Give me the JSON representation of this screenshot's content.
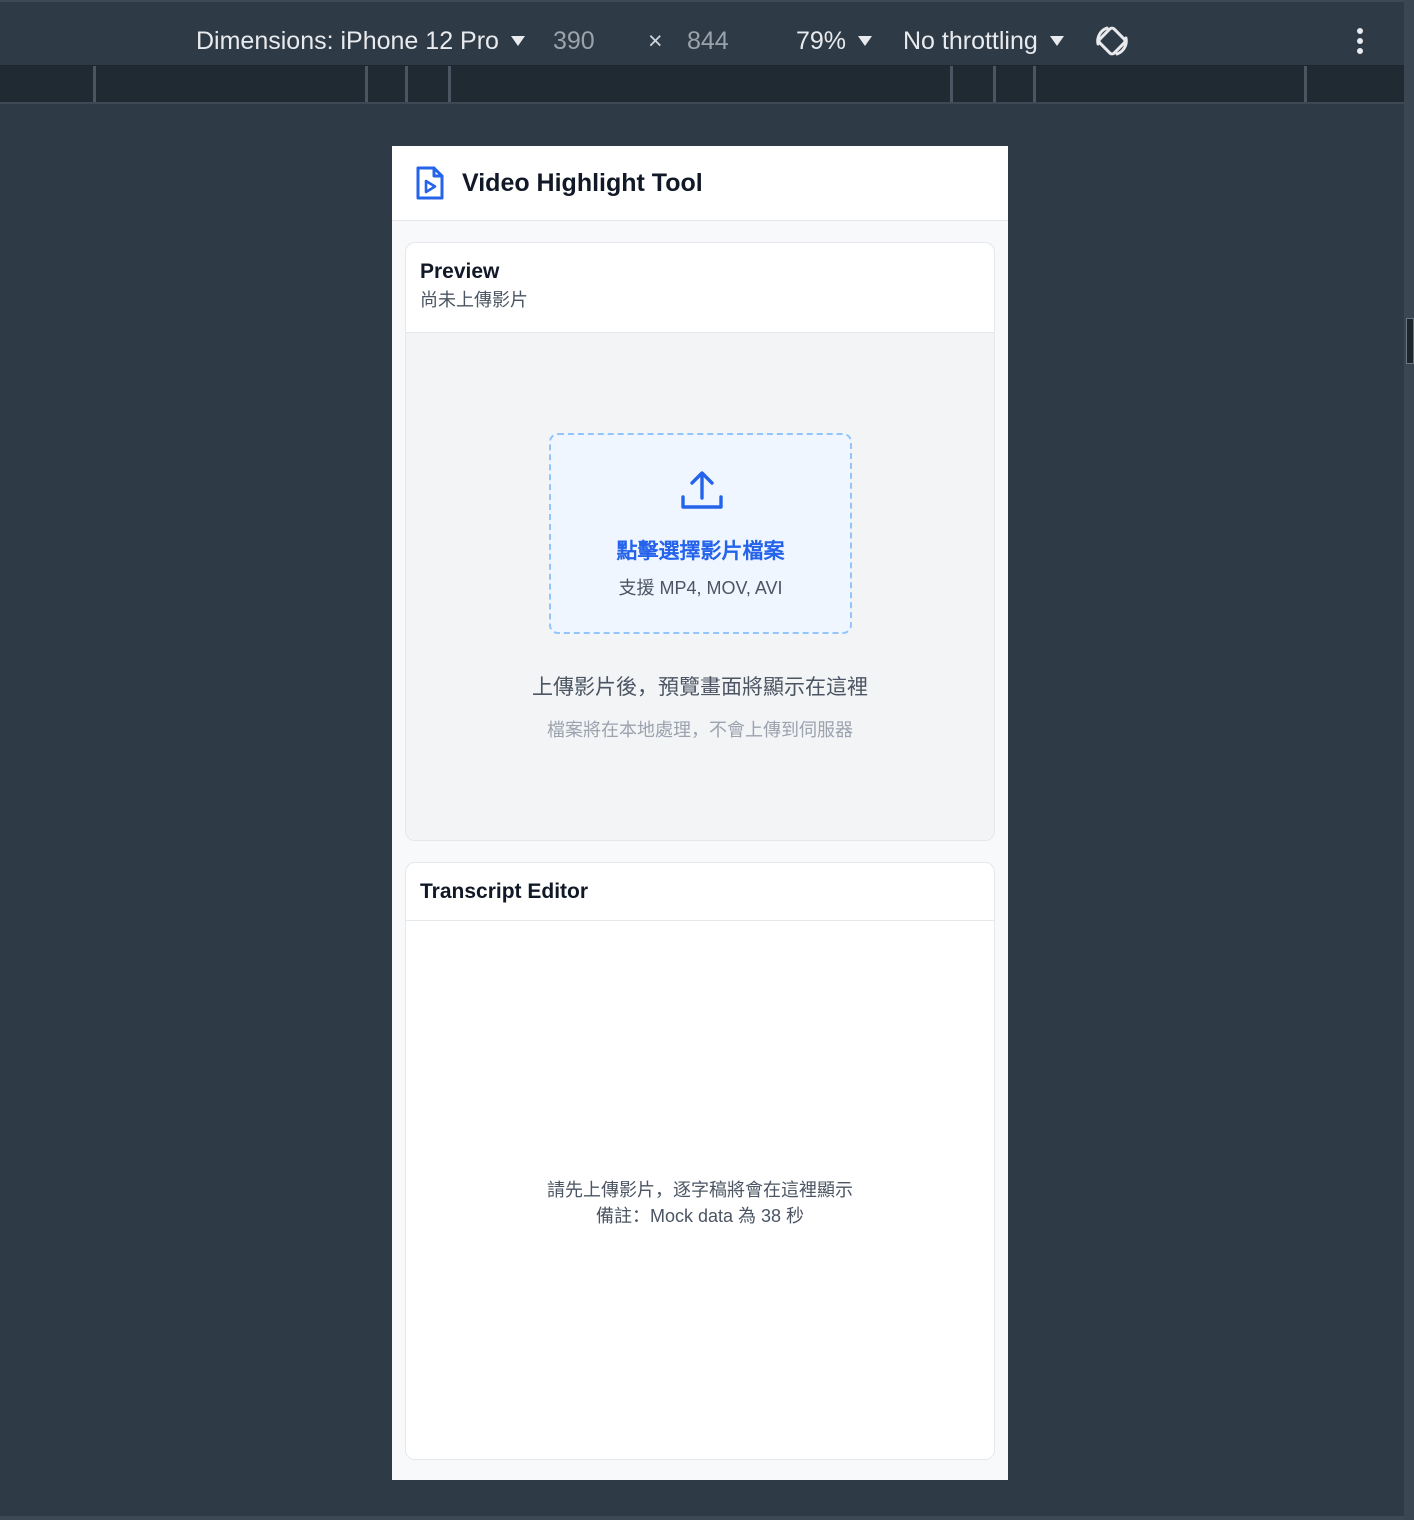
{
  "devtools": {
    "dimensions_label": "Dimensions: iPhone 12 Pro",
    "width_value": "390",
    "times_symbol": "×",
    "height_value": "844",
    "zoom_label": "79%",
    "throttling_label": "No throttling"
  },
  "app": {
    "title": "Video Highlight Tool",
    "accent_color": "#2563eb"
  },
  "preview": {
    "title": "Preview",
    "subtitle": "尚未上傳影片",
    "dropzone_label": "點擊選擇影片檔案",
    "dropzone_hint": "支援 MP4, MOV, AVI",
    "message": "上傳影片後，預覽畫面將顯示在這裡",
    "note": "檔案將在本地處理，不會上傳到伺服器"
  },
  "transcript": {
    "title": "Transcript Editor",
    "empty_line1": "請先上傳影片，逐字稿將會在這裡顯示",
    "empty_line2": "備註：Mock data 為 38 秒"
  },
  "icons": {
    "logo": "file-video-icon",
    "upload": "upload-icon",
    "rotate": "rotate-device-icon",
    "more": "more-vertical-icon"
  }
}
